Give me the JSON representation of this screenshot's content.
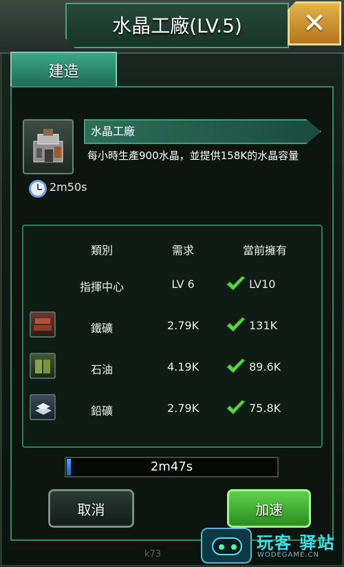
{
  "window": {
    "title": "水晶工廠(LV.5)"
  },
  "tabs": [
    {
      "label": "建造"
    }
  ],
  "building": {
    "name": "水晶工廠",
    "description": "每小時生產900水晶，並提供158K的水晶容量",
    "build_time": "2m50s"
  },
  "requirements": {
    "headers": {
      "type": "類別",
      "need": "需求",
      "have": "當前擁有"
    },
    "rows": [
      {
        "type": "指揮中心",
        "need": "LV 6",
        "have": "LV10",
        "icon": "none"
      },
      {
        "type": "鐵礦",
        "need": "2.79K",
        "have": "131K",
        "icon": "iron-ore-icon"
      },
      {
        "type": "石油",
        "need": "4.19K",
        "have": "89.6K",
        "icon": "oil-barrel-icon"
      },
      {
        "type": "鉛礦",
        "need": "2.79K",
        "have": "75.8K",
        "icon": "lead-ore-icon"
      }
    ]
  },
  "progress": {
    "remaining": "2m47s",
    "fraction": 0.01
  },
  "buttons": {
    "cancel": "取消",
    "speed_up": "加速"
  },
  "watermark": {
    "site_name": "玩客 驿站",
    "site_url": "WODEGAME.CN",
    "k73": "k73"
  },
  "colors": {
    "accent": "#2f8a6d",
    "check": "#5fd14d",
    "close": "#e3b347"
  }
}
